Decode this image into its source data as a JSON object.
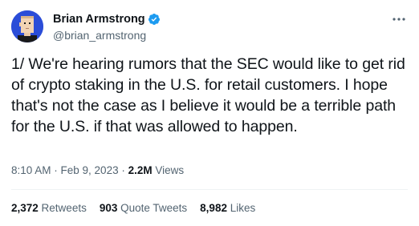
{
  "author": {
    "display_name": "Brian Armstrong",
    "handle": "@brian_armstrong",
    "verified_icon": "verified-badge-icon",
    "avatar_color": "#2b4dd8"
  },
  "tweet": {
    "text": "1/ We're hearing rumors that the SEC would like to get rid of crypto staking in the U.S. for retail customers. I hope that's not the case as I believe it would be a terrible path for the U.S. if that was allowed to happen."
  },
  "meta": {
    "time": "8:10 AM",
    "separator": " · ",
    "date": "Feb 9, 2023",
    "views_count": "2.2M",
    "views_label": " Views"
  },
  "stats": {
    "retweets_count": "2,372",
    "retweets_label": " Retweets",
    "quote_count": "903",
    "quote_label": " Quote Tweets",
    "likes_count": "8,982",
    "likes_label": " Likes"
  },
  "colors": {
    "text_primary": "#0f1419",
    "text_secondary": "#536471",
    "verified": "#1d9bf0"
  }
}
